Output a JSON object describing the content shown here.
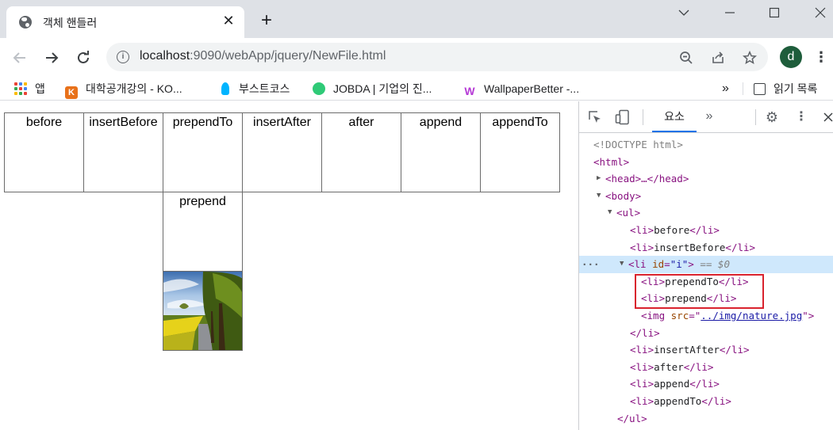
{
  "browser": {
    "tab_title": "객체 핸들러",
    "tab_close": "✕",
    "new_tab": "+",
    "url_host": "localhost",
    "url_path": ":9090/webApp/jquery/NewFile.html",
    "profile_initial": "d",
    "window_controls": {
      "chevron": "⌄",
      "minimize": "—",
      "maximize": "☐",
      "close": "✕"
    },
    "icons": {
      "back": "arrow-left-icon",
      "forward": "arrow-right-icon",
      "reload": "reload-icon",
      "info": "info-icon",
      "zoom": "zoom-icon",
      "share": "share-icon",
      "star": "star-icon",
      "menu": "kebab-menu-icon"
    }
  },
  "bookmarks": {
    "items": [
      {
        "label": "앱",
        "icon": "apps-grid-icon"
      },
      {
        "label": "대학공개강의 - KO...",
        "icon": "kocw-icon"
      },
      {
        "label": "부스트코스",
        "icon": "boostcourse-icon"
      },
      {
        "label": "JOBDA | 기업의 진...",
        "icon": "jobda-icon"
      },
      {
        "label": "WallpaperBetter -...",
        "icon": "wallpaperbetter-icon"
      }
    ],
    "more": "»",
    "reading_list": "읽기 목록"
  },
  "page": {
    "items": [
      "before",
      "insertBefore",
      "prependTo",
      "insertAfter",
      "after",
      "append",
      "appendTo",
      "prepend"
    ],
    "image": "nature-image"
  },
  "devtools": {
    "tab_elements": "요소",
    "more_tabs": "»",
    "dom": {
      "doctype": "<!DOCTYPE html>",
      "html_open": "<html>",
      "head": "<head>…</head>",
      "body_open": "<body>",
      "ul_open": "<ul>",
      "li_before": "before",
      "li_insertBefore": "insertBefore",
      "li_id_attr": "id",
      "li_id_value": "\"i\"",
      "selected_marker": "== $0",
      "li_prependTo": "prependTo",
      "li_prepend": "prepend",
      "img_src_attr": "src",
      "img_src_value": "../img/nature.jpg",
      "li_insertAfter": "insertAfter",
      "li_after": "after",
      "li_append": "append",
      "li_appendTo": "appendTo",
      "ul_close": "</ul>"
    }
  }
}
